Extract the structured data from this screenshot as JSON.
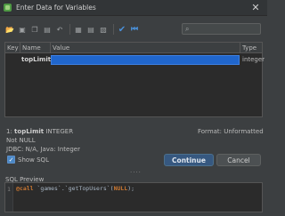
{
  "window": {
    "title": "Enter Data for Variables",
    "close_glyph": "✕"
  },
  "toolbar": {
    "buttons": [
      {
        "name": "open-icon",
        "glyph": "📂"
      },
      {
        "name": "save-icon",
        "glyph": "▣"
      },
      {
        "name": "copy-icon",
        "glyph": "❐"
      },
      {
        "name": "paste-icon",
        "glyph": "▤"
      },
      {
        "name": "revert-icon",
        "glyph": "↶"
      }
    ],
    "buttons2": [
      {
        "name": "grid-icon",
        "glyph": "▦"
      },
      {
        "name": "text-icon",
        "glyph": "▤"
      },
      {
        "name": "view-icon",
        "glyph": "▧"
      }
    ],
    "check_glyph": "✔",
    "prev_glyph": "⏮",
    "search_placeholder": "",
    "search_icon": "⌕"
  },
  "table": {
    "columns": [
      "Key",
      "Name",
      "Value",
      "Type"
    ],
    "rows": [
      {
        "name": "topLimit",
        "value": "",
        "type": "integer"
      }
    ]
  },
  "info": {
    "param_index": "1:",
    "param_name": "topLimit",
    "param_type": "INTEGER",
    "nullability": "Not NULL",
    "jdbc": "JDBC: N/A, Java: Integer",
    "format": "Format: Unformatted",
    "show_sql_label": "Show SQL",
    "show_sql_checked": "✓"
  },
  "buttons": {
    "continue": "Continue",
    "cancel": "Cancel"
  },
  "splitter_glyph": "....",
  "sql_preview": {
    "label": "SQL Preview",
    "line_number": "1",
    "code_at": "@",
    "code_call": "call",
    "code_target": " `games`.`getTopUsers`(",
    "code_null": "NULL",
    "code_end": ");"
  },
  "colors": {
    "background": "#3c3f41",
    "selection": "#2066cc",
    "primary_button": "#365880"
  }
}
